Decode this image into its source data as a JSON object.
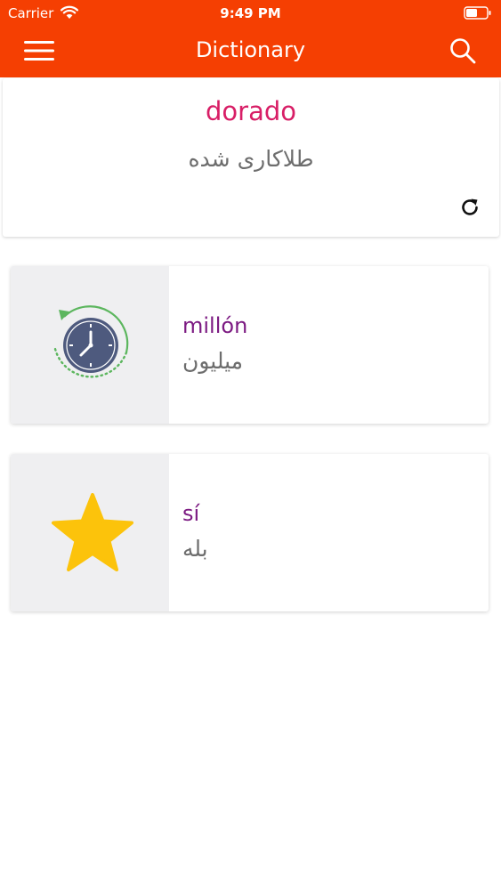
{
  "status_bar": {
    "carrier": "Carrier",
    "time": "9:49 PM",
    "icons": [
      "wifi-icon",
      "battery-icon"
    ]
  },
  "nav": {
    "title": "Dictionary",
    "left_icon": "menu-icon",
    "right_icon": "search-icon"
  },
  "word_of_day": {
    "word": "dorado",
    "translation": "طلاکاری شده",
    "refresh_icon": "refresh-icon"
  },
  "history_card": {
    "icon": "history-clock-icon",
    "term": "millón",
    "meaning": "میلیون"
  },
  "favorites_card": {
    "icon": "star-icon",
    "term": "sí",
    "meaning": "بله"
  },
  "colors": {
    "header": "#f53f02",
    "word_accent": "#d81e66",
    "term_accent": "#7c1a82",
    "star": "#fcc30b",
    "clock_face": "#4e5a7e",
    "clock_ring": "#5cb65e"
  }
}
